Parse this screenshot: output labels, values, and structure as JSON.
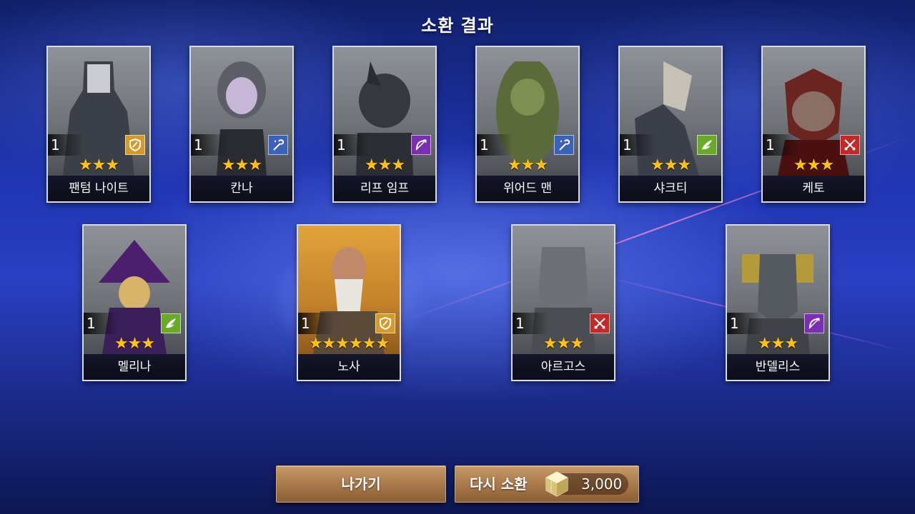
{
  "screen_title": "소환 결과",
  "heroes": [
    {
      "name": "팬텀 나이트",
      "level": "1",
      "stars": "★★★",
      "role_icon": "shield-icon",
      "role_color": "#d49a2a"
    },
    {
      "name": "칸나",
      "level": "1",
      "stars": "★★★",
      "role_icon": "staff-icon",
      "role_color": "#3a62b8"
    },
    {
      "name": "리프 임프",
      "level": "1",
      "stars": "★★★",
      "role_icon": "bow-icon",
      "role_color": "#7a2fb0"
    },
    {
      "name": "위어드 맨",
      "level": "1",
      "stars": "★★★",
      "role_icon": "staff-icon",
      "role_color": "#3a62b8"
    },
    {
      "name": "샤크티",
      "level": "1",
      "stars": "★★★",
      "role_icon": "wing-icon",
      "role_color": "#6aaa2a"
    },
    {
      "name": "케토",
      "level": "1",
      "stars": "★★★",
      "role_icon": "crossed-swords-icon",
      "role_color": "#c02a2a"
    },
    {
      "name": "멜리나",
      "level": "1",
      "stars": "★★★",
      "role_icon": "wing-icon",
      "role_color": "#6aaa2a"
    },
    {
      "name": "노사",
      "level": "1",
      "stars": "★★★★★★",
      "role_icon": "shield-icon",
      "role_color": "#d49a2a"
    },
    {
      "name": "아르고스",
      "level": "1",
      "stars": "★★★",
      "role_icon": "crossed-swords-icon",
      "role_color": "#c02a2a"
    },
    {
      "name": "반델리스",
      "level": "1",
      "stars": "★★★",
      "role_icon": "bow-icon",
      "role_color": "#7a2fb0"
    }
  ],
  "buttons": {
    "exit_label": "나가기",
    "summon_again_label": "다시 소환",
    "summon_cost": "3,000",
    "currency_icon": "crystal-cube-icon"
  }
}
